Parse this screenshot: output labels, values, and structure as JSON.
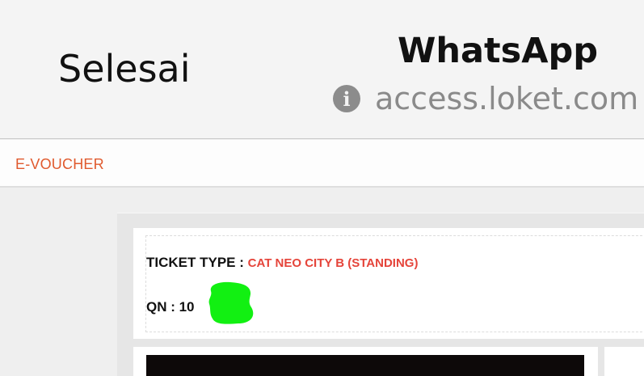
{
  "browser": {
    "done_label": "Selesai",
    "title": "WhatsApp",
    "url": "access.loket.com",
    "info_icon_glyph": "i"
  },
  "page": {
    "section_label": "E-VOUCHER",
    "ticket_type_label": "TICKET TYPE :",
    "ticket_type_value": "CAT NEO CITY B (STANDING)",
    "qn_label": "QN : 10"
  },
  "colors": {
    "accent_orange": "#e05a2e",
    "ticket_value_red": "#e5443a",
    "redaction_green": "#12f012"
  }
}
